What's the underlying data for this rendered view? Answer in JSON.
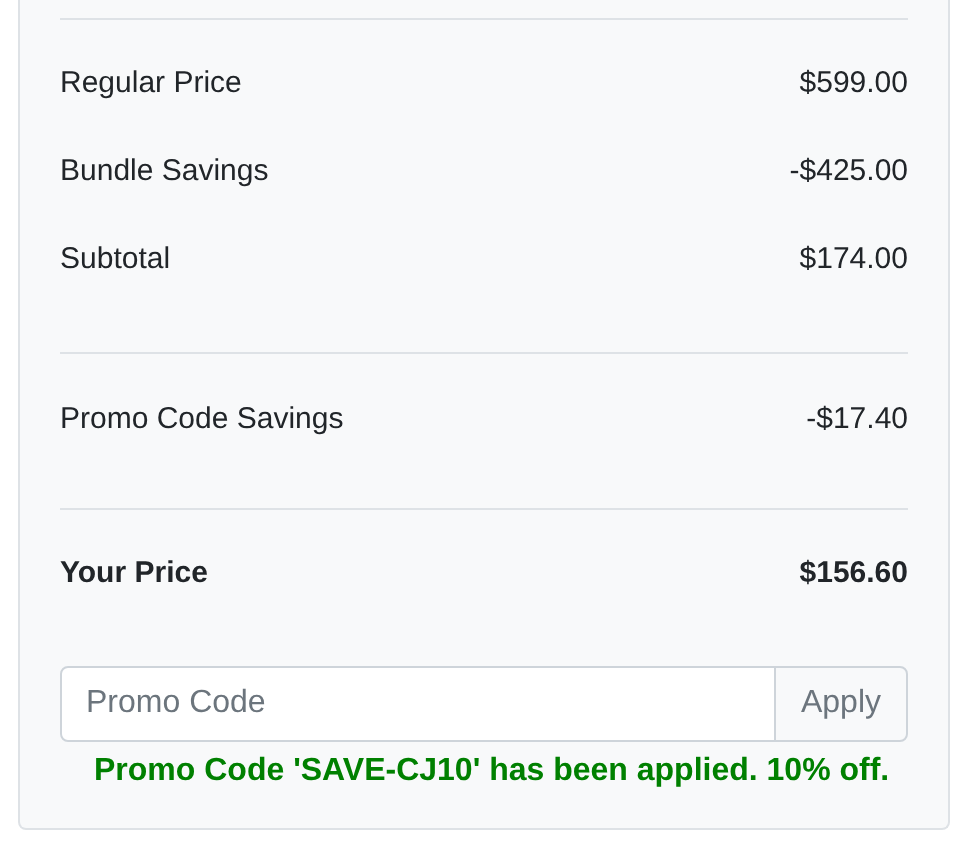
{
  "price_rows": [
    {
      "label": "Regular Price",
      "value": "$599.00"
    },
    {
      "label": "Bundle Savings",
      "value": "-$425.00"
    },
    {
      "label": "Subtotal",
      "value": "$174.00"
    }
  ],
  "promo_savings": {
    "label": "Promo Code Savings",
    "value": "-$17.40"
  },
  "total": {
    "label": "Your Price",
    "value": "$156.60"
  },
  "promo": {
    "placeholder": "Promo Code",
    "button": "Apply",
    "message": "Promo Code 'SAVE-CJ10' has been applied. 10% off."
  }
}
